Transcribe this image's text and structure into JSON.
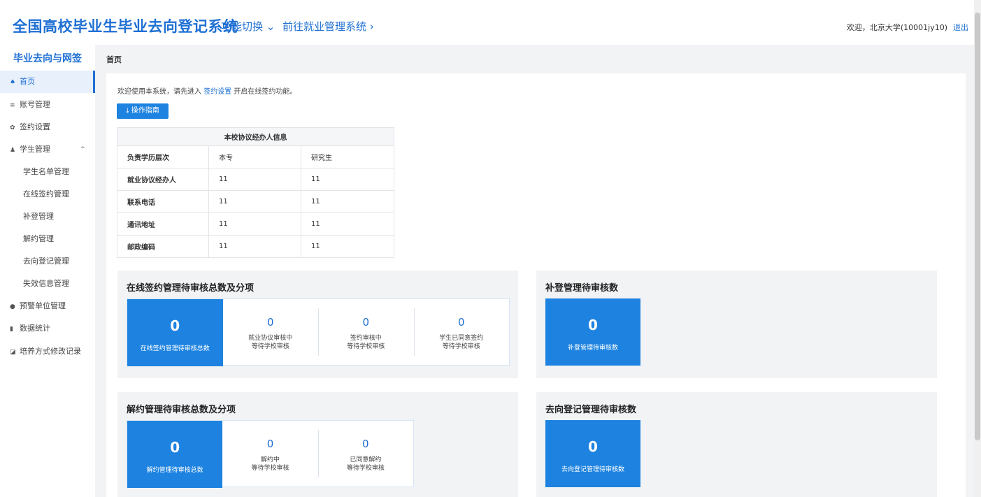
{
  "header": {
    "app_title": "全国高校毕业生毕业去向登记系统",
    "function_switch": "功能切换 ⌄",
    "goto_system": "前往就业管理系统 ›",
    "welcome": "欢迎，北京大学(10001jy10)",
    "logout": "退出"
  },
  "sidebar": {
    "title": "毕业去向与网签",
    "items": [
      {
        "label": "首页",
        "icon": "home-icon",
        "glyph": "♠"
      },
      {
        "label": "账号管理",
        "icon": "list-icon",
        "glyph": "≡"
      },
      {
        "label": "签约设置",
        "icon": "gear-icon",
        "glyph": "✿"
      },
      {
        "label": "学生管理",
        "icon": "user-icon",
        "glyph": "♟",
        "chevron": "^"
      },
      {
        "label": "学生名单管理"
      },
      {
        "label": "在线签约管理"
      },
      {
        "label": "补登管理"
      },
      {
        "label": "解约管理"
      },
      {
        "label": "去向登记管理"
      },
      {
        "label": "失效信息管理"
      },
      {
        "label": "预警单位管理",
        "icon": "alert-icon",
        "glyph": "●"
      },
      {
        "label": "数据统计",
        "icon": "chart-icon",
        "glyph": "▮"
      },
      {
        "label": "培养方式修改记录",
        "icon": "edit-icon",
        "glyph": "◪"
      }
    ]
  },
  "breadcrumb": "首页",
  "intro": {
    "prefix": "欢迎使用本系统，请先进入 ",
    "link": "签约设置",
    "suffix": " 开启在线签约功能。"
  },
  "guide_button": "⤓ 操作指南",
  "info_table": {
    "title": "本校协议经办人信息",
    "header": [
      "负责学历层次",
      "本专",
      "研究生"
    ],
    "rows": [
      [
        "就业协议经办人",
        "11",
        "11"
      ],
      [
        "联系电话",
        "11",
        "11"
      ],
      [
        "通讯地址",
        "11",
        "11"
      ],
      [
        "邮政编码",
        "11",
        "11"
      ]
    ]
  },
  "online_sign": {
    "title": "在线签约管理待审核总数及分项",
    "main": {
      "value": "0",
      "label": "在线签约管理待审核总数"
    },
    "subs": [
      {
        "value": "0",
        "line1": "就业协议审核中",
        "line2": "等待学校审核"
      },
      {
        "value": "0",
        "line1": "签约审核中",
        "line2": "等待学校审核"
      },
      {
        "value": "0",
        "line1": "学生已同意签约",
        "line2": "等待学校审核"
      }
    ]
  },
  "supplement": {
    "title": "补登管理待审核数",
    "value": "0",
    "label": "补登管理待审核数"
  },
  "cancel": {
    "title": "解约管理待审核总数及分项",
    "main": {
      "value": "0",
      "label": "解约管理待审核总数"
    },
    "subs": [
      {
        "value": "0",
        "line1": "解约中",
        "line2": "等待学校审核"
      },
      {
        "value": "0",
        "line1": "已同意解约",
        "line2": "等待学校审核"
      }
    ]
  },
  "destination": {
    "title": "去向登记管理待审核数",
    "value": "0",
    "label": "去向登记管理待审核数"
  },
  "colors": {
    "primary": "#1e6fd3",
    "tile": "#1e83e0",
    "background": "#f2f3f5"
  }
}
